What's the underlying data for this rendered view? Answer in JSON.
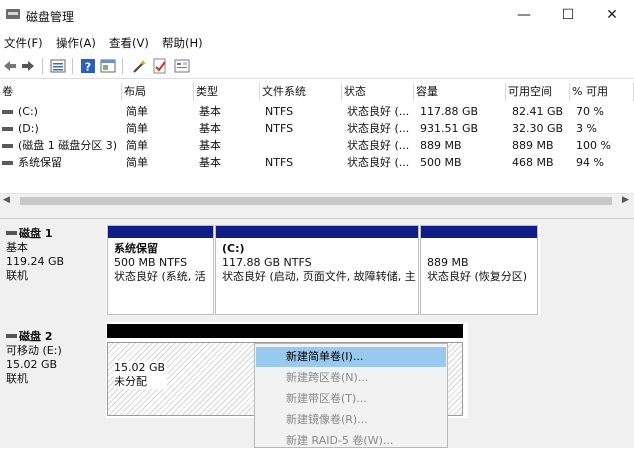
{
  "window": {
    "title": "磁盘管理",
    "minimize": "—",
    "maximize": "☐",
    "close": "✕"
  },
  "menu": [
    "文件(F)",
    "操作(A)",
    "查看(V)",
    "帮助(H)"
  ],
  "toolbar": [
    "back-icon",
    "forward-icon",
    "list-view-icon",
    "help-icon",
    "properties-icon",
    "wand-icon",
    "check-icon",
    "export-icon"
  ],
  "volume_table": {
    "headers": [
      "卷",
      "布局",
      "类型",
      "文件系统",
      "状态",
      "容量",
      "可用空间",
      "% 可用"
    ],
    "rows": [
      [
        "(C:)",
        "简单",
        "基本",
        "NTFS",
        "状态良好 (...",
        "117.88 GB",
        "82.41 GB",
        "70 %"
      ],
      [
        "(D:)",
        "简单",
        "基本",
        "NTFS",
        "状态良好 (...",
        "931.51 GB",
        "32.30 GB",
        "3 %"
      ],
      [
        "(磁盘 1 磁盘分区 3)",
        "简单",
        "基本",
        "",
        "状态良好 (...",
        "889 MB",
        "889 MB",
        "100 %"
      ],
      [
        "系统保留",
        "简单",
        "基本",
        "NTFS",
        "状态良好 (...",
        "500 MB",
        "468 MB",
        "94 %"
      ]
    ]
  },
  "disks": [
    {
      "name": "磁盘 1",
      "type": "基本",
      "size": "119.24 GB",
      "status": "联机",
      "partitions": [
        {
          "title": "系统保留",
          "size_fs": "500 MB NTFS",
          "status": "状态良好 (系统, 活"
        },
        {
          "title": "(C:)",
          "size_fs": "117.88 GB NTFS",
          "status": "状态良好 (启动, 页面文件, 故障转储, 主"
        },
        {
          "title": "",
          "size_fs": "889 MB",
          "status": "状态良好 (恢复分区)"
        }
      ]
    },
    {
      "name": "磁盘 2",
      "type": "可移动 (E:)",
      "size": "15.02 GB",
      "status": "联机",
      "partitions": [
        {
          "size": "15.02 GB",
          "state": "未分配"
        }
      ]
    }
  ],
  "context_menu": [
    {
      "label": "新建简单卷(I)...",
      "enabled": true,
      "highlighted": true
    },
    {
      "label": "新建跨区卷(N)...",
      "enabled": false
    },
    {
      "label": "新建带区卷(T)...",
      "enabled": false
    },
    {
      "label": "新建镜像卷(R)...",
      "enabled": false
    },
    {
      "label": "新建 RAID-5 卷(W)...",
      "enabled": false
    }
  ]
}
